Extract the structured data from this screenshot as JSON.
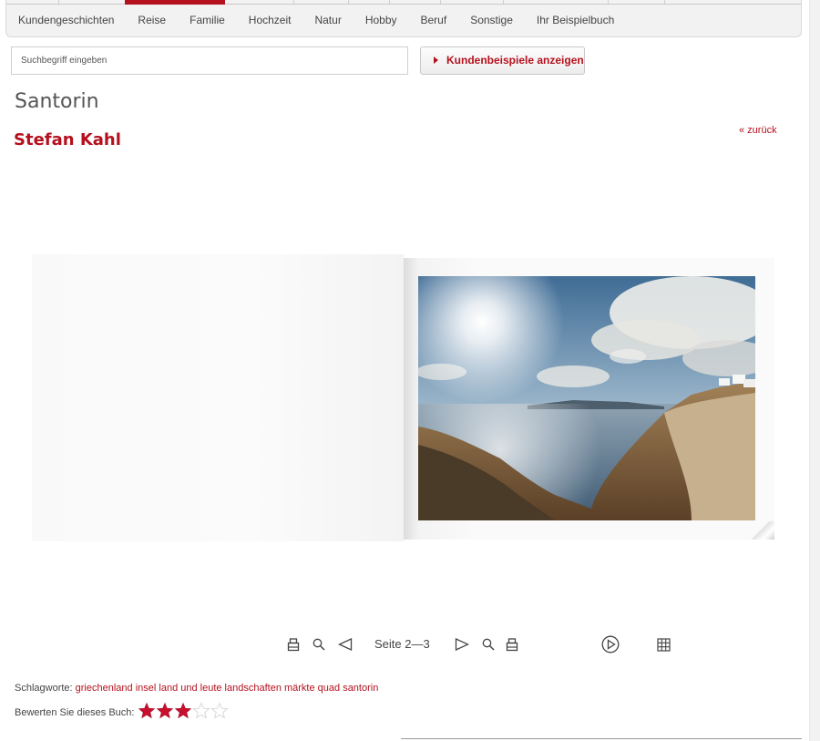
{
  "nav": {
    "items": [
      {
        "label": "Kundengeschichten"
      },
      {
        "label": "Reise"
      },
      {
        "label": "Familie"
      },
      {
        "label": "Hochzeit"
      },
      {
        "label": "Natur"
      },
      {
        "label": "Hobby"
      },
      {
        "label": "Beruf"
      },
      {
        "label": "Sonstige"
      },
      {
        "label": "Ihr Beispielbuch"
      }
    ],
    "accent_color": "#b4101d"
  },
  "search": {
    "placeholder": "Suchbegriff eingeben",
    "button_label": "Kundenbeispiele anzeigen"
  },
  "book": {
    "title": "Santorin",
    "author": "Stefan Kahl",
    "back_label": "« zurück"
  },
  "viewer": {
    "page_indicator": "Seite 2—3",
    "icons": [
      "print-icon",
      "zoom-icon",
      "prev-arrow-icon",
      "next-arrow-icon",
      "zoom-icon",
      "print-icon",
      "play-icon",
      "grid-icon"
    ]
  },
  "footer": {
    "keywords_label": "Schlagworte:",
    "keywords": "griechenland insel land und leute landschaften märkte quad santorin",
    "rating_label": "Bewerten Sie dieses Buch:",
    "rating_value": 3,
    "rating_max": 5
  }
}
